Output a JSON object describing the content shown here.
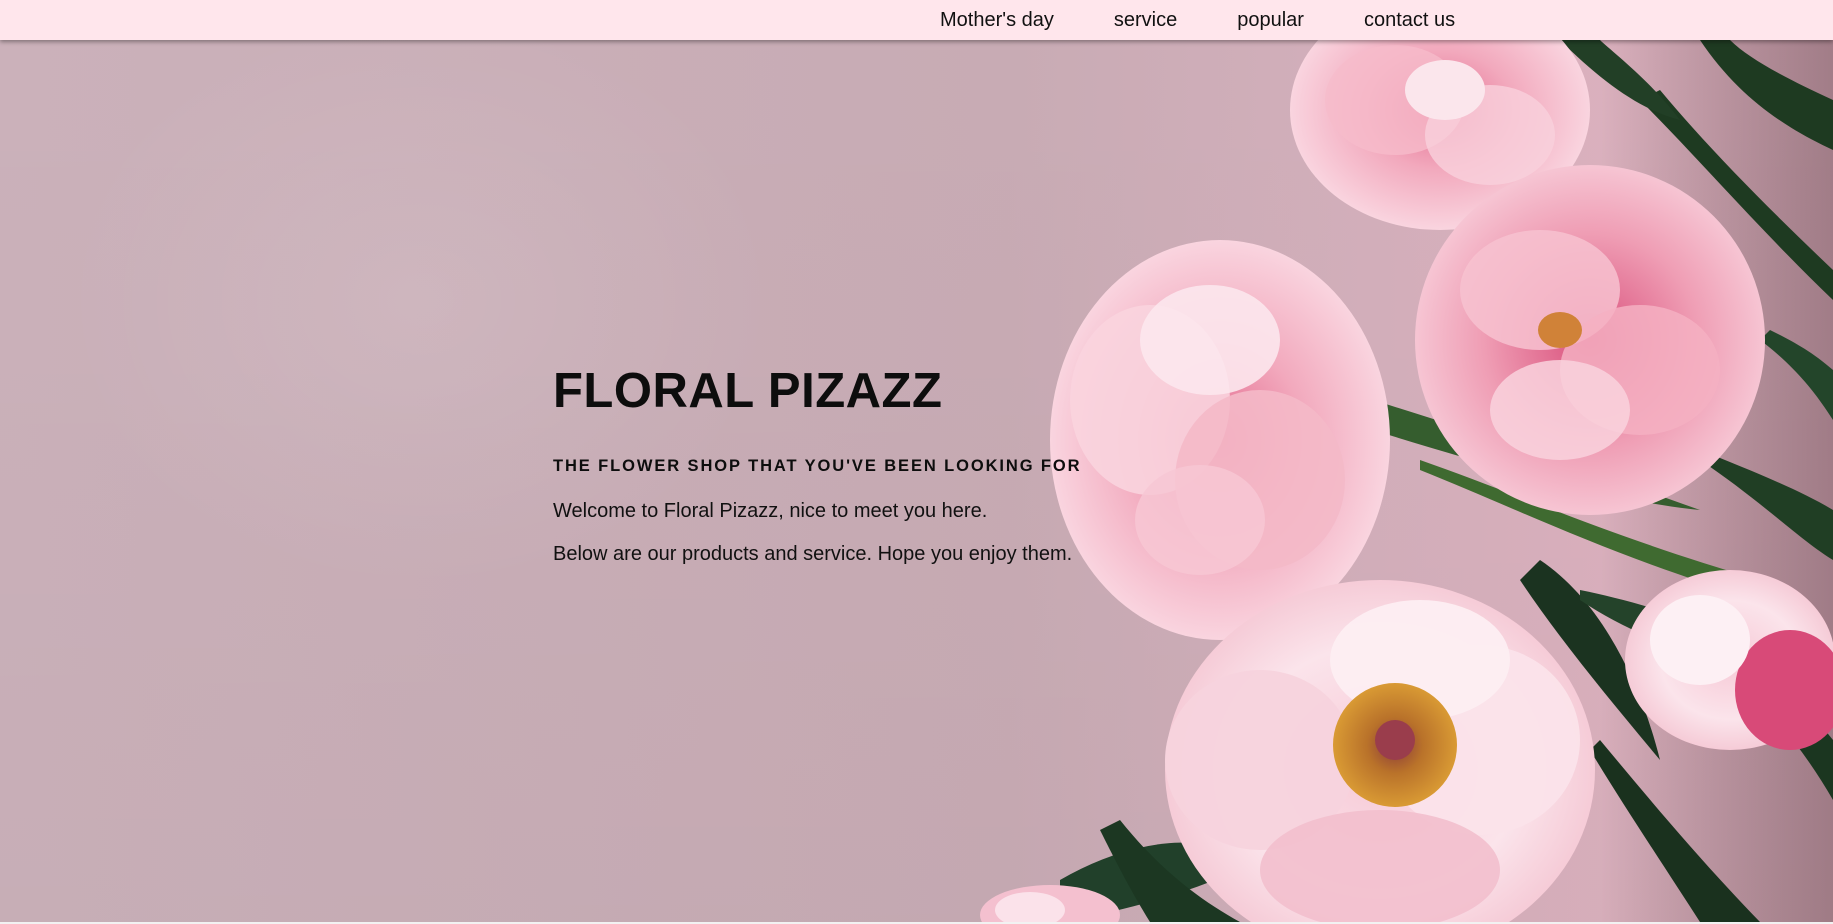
{
  "nav": {
    "items": [
      {
        "label": "Mother's day"
      },
      {
        "label": "service"
      },
      {
        "label": "popular"
      },
      {
        "label": "contact us"
      }
    ]
  },
  "hero": {
    "title": "FLORAL PIZAZZ",
    "tagline": "THE FLOWER SHOP THAT YOU'VE BEEN LOOKING FOR",
    "lines": [
      "Welcome to Floral Pizazz, nice to meet you here.",
      "Below are our products and service. Hope you enjoy them."
    ]
  },
  "colors": {
    "header_bg": "#ffe6ec",
    "hero_bg": "#c9aeb7",
    "petal_pink": "#f2b6c6",
    "petal_light": "#fbe1e8",
    "leaf_green": "#1f3b22",
    "stamen_gold": "#c9882a"
  }
}
